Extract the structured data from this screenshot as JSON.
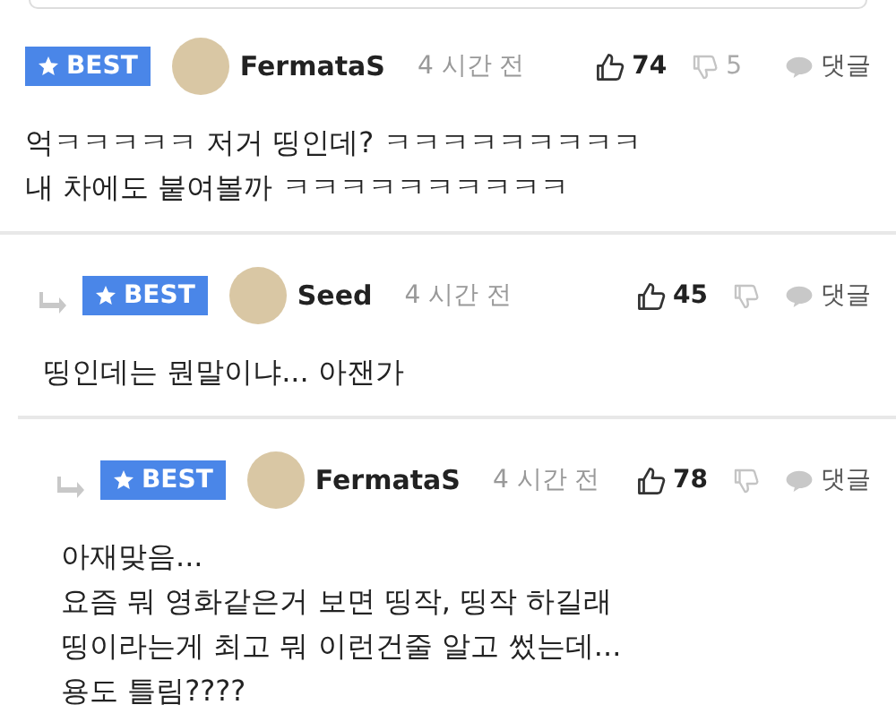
{
  "comments": [
    {
      "best": true,
      "badge": "BEST",
      "author": "FermataS",
      "time": "4 시간 전",
      "likes": "74",
      "dislikes": "5",
      "reply_label": "댓글",
      "lines": [
        "억ㅋㅋㅋㅋㅋ 저거 띵인데? ㅋㅋㅋㅋㅋㅋㅋㅋㅋ",
        "내 차에도 붙여볼까 ㅋㅋㅋㅋㅋㅋㅋㅋㅋㅋ"
      ],
      "children": [
        {
          "best": true,
          "badge": "BEST",
          "author": "Seed",
          "time": "4 시간 전",
          "likes": "45",
          "reply_label": "댓글",
          "lines": [
            "띵인데는 뭔말이냐... 아잰가"
          ],
          "children": [
            {
              "best": true,
              "badge": "BEST",
              "author": "FermataS",
              "time": "4 시간 전",
              "likes": "78",
              "reply_label": "댓글",
              "lines": [
                "아재맞음...",
                "요즘 뭐 영화같은거 보면 띵작, 띵작 하길래",
                "띵이라는게 최고 뭐 이런건줄 알고 썼는데...",
                "용도 틀림????"
              ]
            }
          ]
        }
      ]
    }
  ]
}
